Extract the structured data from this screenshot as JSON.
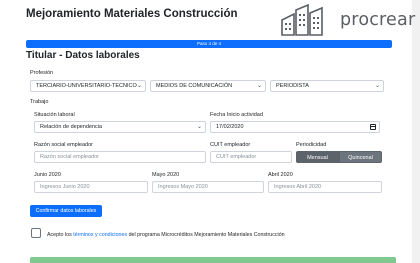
{
  "header": {
    "title": "Mejoramiento Materiales Construcción",
    "logo_text": "procrear"
  },
  "progress": {
    "label": "Paso 4 de 4",
    "fraction": 1.0
  },
  "section_title": "Titular - Datos laborales",
  "profesion": {
    "label": "Profesión",
    "select1": "TERCIARIO-UNIVERSITARIO-TECNICO",
    "select2": "MEDIOS DE COMUNICACIÓN",
    "select3": "PERIODISTA"
  },
  "trabajo": {
    "label": "Trabajo",
    "situacion_label": "Situación laboral",
    "situacion_value": "Relación de dependencia",
    "fecha_label": "Fecha Inicio actividad",
    "fecha_value": "17/02/2020",
    "razon_label": "Razón social empleador",
    "razon_placeholder": "Razón social empleador",
    "cuit_label": "CUIT empleador",
    "cuit_placeholder": "CUIT empleador",
    "periodicidad_label": "Periodicidad",
    "periodicidad_options": [
      "Mensual",
      "Quincenal"
    ],
    "junio_label": "Junio 2020",
    "junio_placeholder": "Ingresos Junio 2020",
    "mayo_label": "Mayo 2020",
    "mayo_placeholder": "Ingresos Mayo 2020",
    "abril_label": "Abril 2020",
    "abril_placeholder": "Ingresos Abril 2020"
  },
  "confirm_button": "Confirmar datos laborales",
  "terms": {
    "prefix": "Acepto los ",
    "link": "términos y condiciones",
    "suffix": " del programa Microcréditos Mejoramiento Materiales Construcción"
  },
  "colors": {
    "primary": "#0d6efd",
    "toggle_active": "#5c636a",
    "submit_green": "#7fc98f"
  }
}
